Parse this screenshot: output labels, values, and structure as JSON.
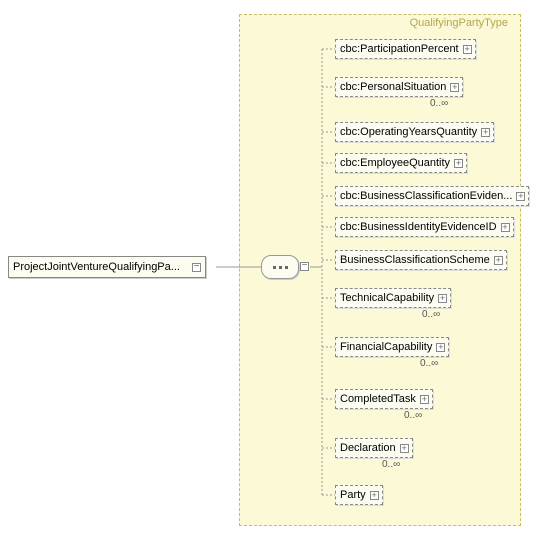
{
  "root": {
    "label": "ProjectJointVentureQualifyingPa..."
  },
  "type_container_label": "QualifyingPartyType",
  "children": [
    {
      "label": "cbc:ParticipationPercent",
      "card": ""
    },
    {
      "label": "cbc:PersonalSituation",
      "card": "0..∞"
    },
    {
      "label": "cbc:OperatingYearsQuantity",
      "card": ""
    },
    {
      "label": "cbc:EmployeeQuantity",
      "card": ""
    },
    {
      "label": "cbc:BusinessClassificationEviden...",
      "card": ""
    },
    {
      "label": "cbc:BusinessIdentityEvidenceID",
      "card": ""
    },
    {
      "label": "BusinessClassificationScheme",
      "card": ""
    },
    {
      "label": "TechnicalCapability",
      "card": "0..∞"
    },
    {
      "label": "FinancialCapability",
      "card": "0..∞"
    },
    {
      "label": "CompletedTask",
      "card": "0..∞"
    },
    {
      "label": "Declaration",
      "card": "0..∞"
    },
    {
      "label": "Party",
      "card": ""
    }
  ]
}
